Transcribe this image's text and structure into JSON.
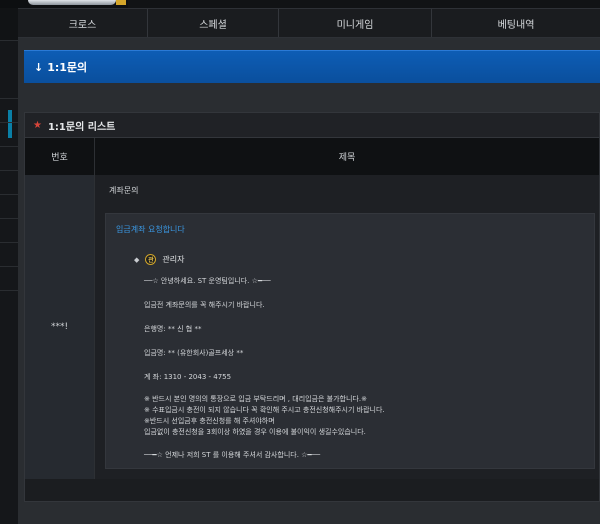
{
  "nav": {
    "items": [
      "크로스",
      "스페셜",
      "미니게임",
      "베팅내역"
    ]
  },
  "banner": {
    "arrow": "↓",
    "title": "1:1문의"
  },
  "list": {
    "title": "1:1문의 리스트",
    "columns": {
      "no": "번호",
      "subject": "제목"
    },
    "row": {
      "no": "***!",
      "subject": "계좌문의",
      "content_title": "입금계좌 요청합니다",
      "author_badge": "관",
      "author": "관리자",
      "lines": [
        "──☆ 안녕하세요. ST 운영팀입니다. ☆━──",
        "입금전 계좌문의를 꼭 해주시기 바랍니다.",
        "은행명: ** 신  협  **",
        "입금명: ** (유한회사)골프세상  **",
        "계   좌:   1310 - 2043 - 4755",
        "※ 반드시 본인 명의의 통장으로 입금 부탁드리며 , 대리입금은 불가합니다.※",
        "※ 수표입금시 충전이 되지 않습니다 꼭 확인해 주시고 충전신청해주시기 바랍니다.",
        "※반드시 선입금후 충전신청를 해 주셔야하며",
        "입금없이 충전신청을 3회이상 하였을 경우 이용에 불이익이 생길수있습니다.",
        "──━☆ 언제나 저희 ST 를  이용해 주셔서 감사합니다.  ☆━──"
      ]
    }
  },
  "colors": {
    "banner": "#0a56a8",
    "link_blue": "#3a97e2",
    "star_red": "#d8453a"
  }
}
